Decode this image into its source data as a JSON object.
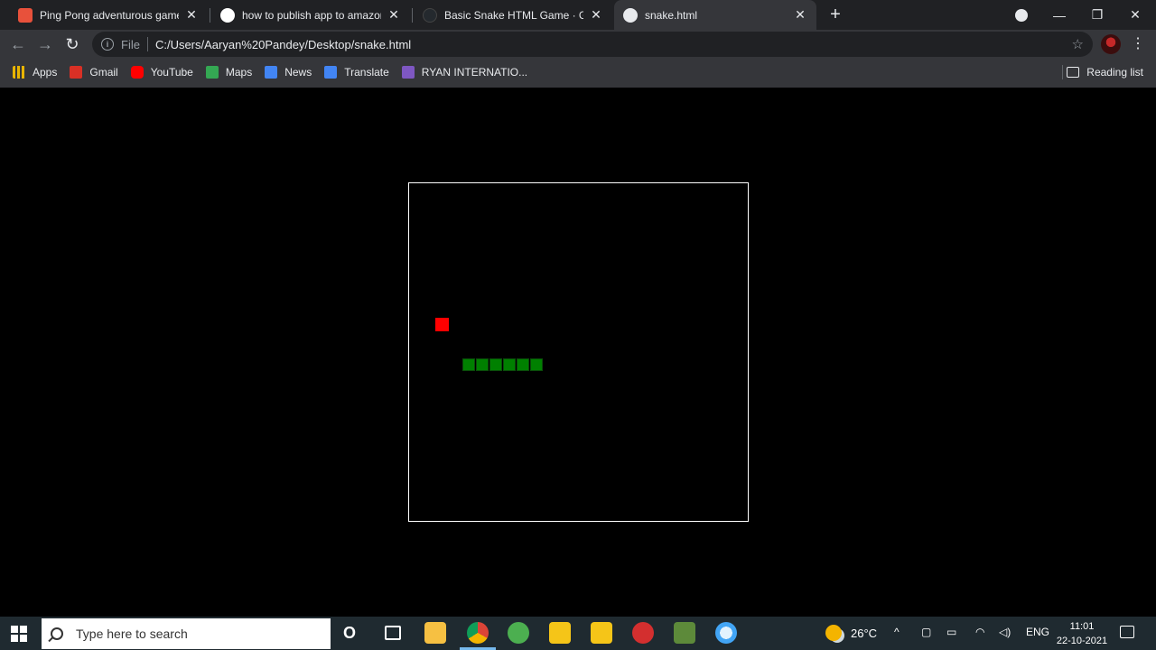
{
  "browser": {
    "tabs": [
      {
        "title": "Ping Pong adventurous game by",
        "favicon_color": "#e8513b"
      },
      {
        "title": "how to publish app to amazon ap",
        "favicon_color": "#ffffff"
      },
      {
        "title": "Basic Snake HTML Game · GitHub",
        "favicon_color": "#24292e"
      },
      {
        "title": "snake.html",
        "favicon_color": "#e8eaed"
      }
    ],
    "new_tab": "+",
    "window_controls": {
      "minimize": "—",
      "restore": "❐",
      "close": "✕"
    },
    "nav": {
      "back": "←",
      "forward": "→",
      "reload": "↻"
    },
    "address": {
      "scheme_label": "File",
      "url": "C:/Users/Aaryan%20Pandey/Desktop/snake.html",
      "star": "☆"
    },
    "menu": "⋮",
    "bookmarks": [
      {
        "label": "Apps",
        "icon": "apps-grid-icon",
        "color": "#e8b400"
      },
      {
        "label": "Gmail",
        "icon": "gmail-icon",
        "color": "#d93025"
      },
      {
        "label": "YouTube",
        "icon": "youtube-icon",
        "color": "#ff0000"
      },
      {
        "label": "Maps",
        "icon": "maps-icon",
        "color": "#34a853"
      },
      {
        "label": "News",
        "icon": "news-icon",
        "color": "#4285f4"
      },
      {
        "label": "Translate",
        "icon": "translate-icon",
        "color": "#4285f4"
      },
      {
        "label": "RYAN INTERNATIO...",
        "icon": "ryan-icon",
        "color": "#7e57c2"
      }
    ],
    "reading_list": "Reading list"
  },
  "game": {
    "board_border_color": "#ffffff",
    "food_color": "#ff0000",
    "snake_color": "#008000",
    "snake_length": 6
  },
  "taskbar": {
    "search_placeholder": "Type here to search",
    "cortana": "O",
    "apps": [
      {
        "icon": "file-explorer-icon",
        "color": "#f6c042"
      },
      {
        "icon": "chrome-icon",
        "color": "#4caf50"
      },
      {
        "icon": "utorrent-icon",
        "color": "#4caf50"
      },
      {
        "icon": "app-yellow-1-icon",
        "color": "#f5c518"
      },
      {
        "icon": "app-yellow-2-icon",
        "color": "#f5c518"
      },
      {
        "icon": "app-red-icon",
        "color": "#d32f2f"
      },
      {
        "icon": "minecraft-icon",
        "color": "#5d8a3a"
      },
      {
        "icon": "globe-app-icon",
        "color": "#90caf9"
      }
    ],
    "weather": "26°C",
    "language": "ENG",
    "time": "11:01",
    "date": "22-10-2021"
  }
}
